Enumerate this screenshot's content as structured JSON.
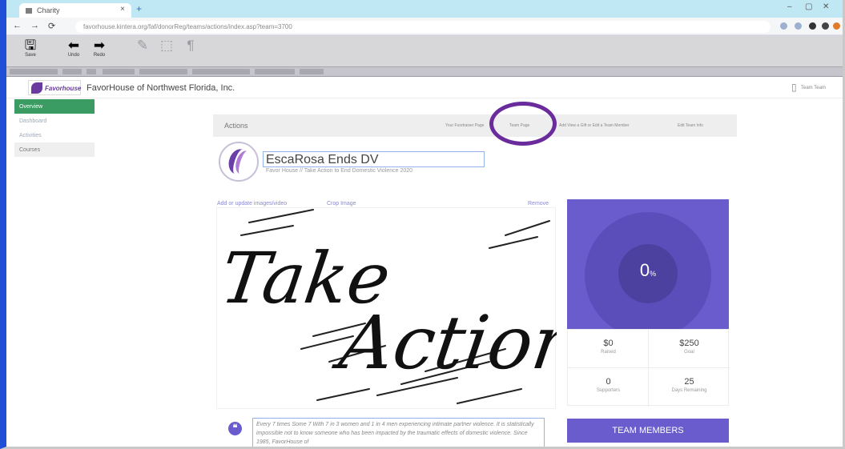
{
  "browser": {
    "tab_title": "Charity",
    "tab_close": "×",
    "new_tab": "+",
    "url": "favorhouse.kintera.org/faf/donorReg/teams/actions/index.asp?team=3700",
    "window_controls": [
      "–",
      "▢",
      "✕"
    ]
  },
  "toolbar": {
    "save_label": "Save",
    "undo_label": "Undo",
    "redo_label": "Redo",
    "tool1_label": "",
    "tool2_label": "",
    "tool3_label": ""
  },
  "org": {
    "logo_text": "Favorhouse",
    "name": "FavorHouse of Northwest Florida, Inc.",
    "user_label": "Team Team"
  },
  "sidebar": {
    "items": [
      {
        "label": "Overview"
      },
      {
        "label": "Dashboard"
      },
      {
        "label": "Activities"
      },
      {
        "label": "Courses"
      }
    ]
  },
  "actions": {
    "title": "Actions",
    "links": [
      "Your Fundraiser Page",
      "Team Page",
      "Add View a Gift or Edit a Team Member",
      "Edit Team Info"
    ]
  },
  "team": {
    "name": "EscaRosa Ends DV",
    "subtitle": "Favor House // Take Action to End Domestic Violence 2020"
  },
  "image_links": {
    "update": "Add or update images/video",
    "crop": "Crop Image",
    "remove": "Remove"
  },
  "hero_text": {
    "line1": "Take",
    "line2": "Action"
  },
  "story": {
    "quote_icon": "❝",
    "text": "Every 7 times Some 7 With 7 in 3 women and 1 in 4 men experiencing intimate partner violence. It is statistically impossible not to know someone who has been impacted by the traumatic effects of domestic violence. Since 1985, FavorHouse of"
  },
  "progress": {
    "percent": "0",
    "percent_sign": "%",
    "fraction": 0
  },
  "stats": [
    {
      "value": "$0",
      "label": "Raised"
    },
    {
      "value": "$250",
      "label": "Goal"
    },
    {
      "value": "0",
      "label": "Supporters"
    },
    {
      "value": "25",
      "label": "Days Remaining"
    }
  ],
  "team_members_button": "TEAM MEMBERS",
  "colors": {
    "accent": "#6a5ccc",
    "highlight_circle": "#6a2c9c",
    "sidebar_active": "#3a9c63",
    "window_border": "#1e4fd6"
  }
}
